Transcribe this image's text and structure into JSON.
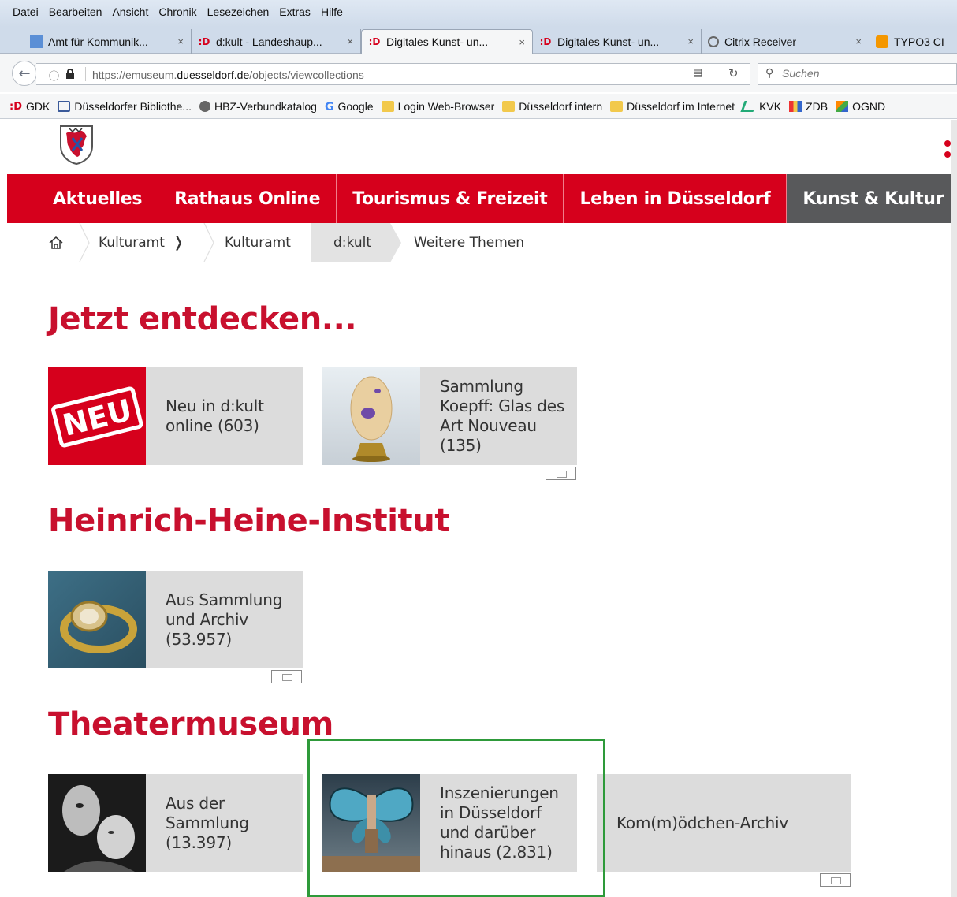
{
  "browser": {
    "menu": [
      "Datei",
      "Bearbeiten",
      "Ansicht",
      "Chronik",
      "Lesezeichen",
      "Extras",
      "Hilfe"
    ],
    "tabs": [
      {
        "title": "Amt für Kommunik...",
        "icon": "amt-favicon",
        "close": "×"
      },
      {
        "title": "d:kult - Landeshaup...",
        "icon": "d-favicon",
        "close": "×"
      },
      {
        "title": "Digitales Kunst- un...",
        "icon": "d-favicon",
        "close": "×"
      },
      {
        "title": "Digitales Kunst- un...",
        "icon": "d-favicon",
        "close": "×"
      },
      {
        "title": "Citrix Receiver",
        "icon": "citrix-favicon",
        "close": "×"
      },
      {
        "title": "TYPO3 CI",
        "icon": "typo3-favicon",
        "close": ""
      }
    ],
    "url_prefix": "https://emuseum.",
    "url_domain": "duesseldorf.de",
    "url_path": "/objects/viewcollections",
    "search_placeholder": "Suchen",
    "bookmarks": [
      {
        "label": "GDK",
        "icon": "d-icon"
      },
      {
        "label": "Düsseldorfer Bibliothe...",
        "icon": "library-icon"
      },
      {
        "label": "HBZ-Verbundkatalog",
        "icon": "globe-icon"
      },
      {
        "label": "Google",
        "icon": "google-icon"
      },
      {
        "label": "Login Web-Browser",
        "icon": "folder-icon"
      },
      {
        "label": "Düsseldorf intern",
        "icon": "folder-icon"
      },
      {
        "label": "Düsseldorf im Internet",
        "icon": "folder-icon"
      },
      {
        "label": "KVK",
        "icon": "kvk-icon"
      },
      {
        "label": "ZDB",
        "icon": "zdb-icon"
      },
      {
        "label": "OGND",
        "icon": "ognd-icon"
      }
    ]
  },
  "site": {
    "nav": [
      "Aktuelles",
      "Rathaus Online",
      "Tourismus & Freizeit",
      "Leben in Düsseldorf",
      "Kunst & Kultur"
    ],
    "breadcrumb": [
      "Kulturamt",
      "Kulturamt",
      "d:kult",
      "Weitere Themen"
    ],
    "breadcrumb_chevron": "❭",
    "sections": [
      {
        "title": "Jetzt entdecken...",
        "cards": [
          {
            "label": "Neu in d:kult online (603)",
            "image": "neu-stamp"
          },
          {
            "label": "Sammlung Koepff: Glas des Art Nouveau (135)",
            "image": "glass-vase"
          }
        ]
      },
      {
        "title": "Heinrich-Heine-Institut",
        "cards": [
          {
            "label": "Aus Sammlung und Archiv (53.957)",
            "image": "ring-photo"
          }
        ]
      },
      {
        "title": "Theatermuseum",
        "cards": [
          {
            "label": "Aus der Sammlung (13.397)",
            "image": "theatre-faces"
          },
          {
            "label": "Inszenierungen in Düsseldorf und darüber hinaus (2.831)",
            "image": "butterfly-stage"
          },
          {
            "label": "Kom(m)ödchen-Archiv",
            "image": ""
          }
        ]
      }
    ],
    "neu_stamp_text": "NEU"
  },
  "colors": {
    "brand_red": "#d6001c",
    "title_red": "#c8102e",
    "card_grey": "#dcdcdc",
    "nav_dark": "#58595b",
    "highlight_green": "#2e9a3a"
  }
}
